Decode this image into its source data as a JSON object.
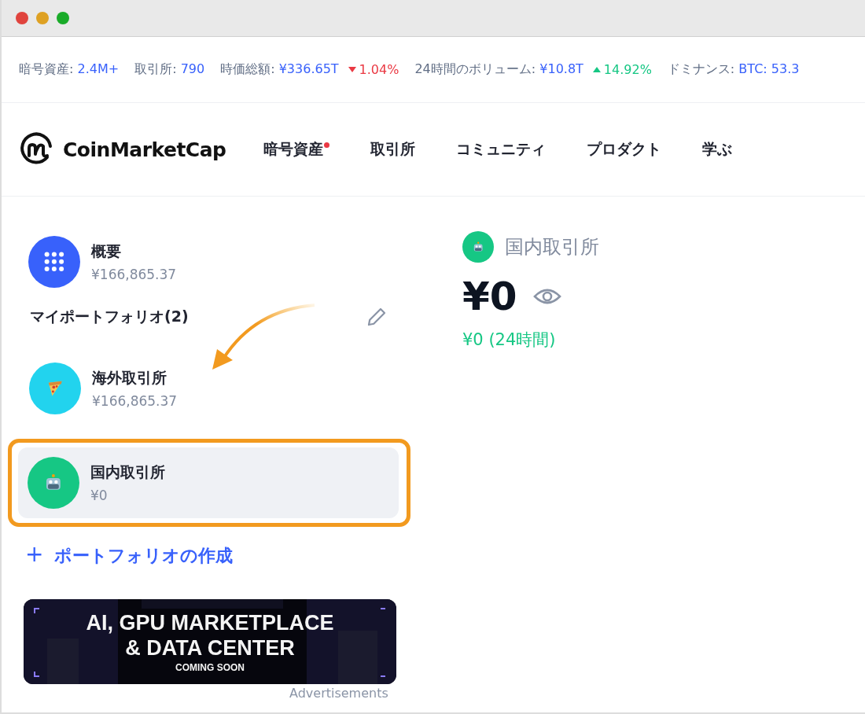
{
  "ticker": [
    {
      "label": "暗号資産:",
      "value": "2.4M+"
    },
    {
      "label": "取引所:",
      "value": "790"
    },
    {
      "label": "時価総額:",
      "value": "¥336.65T",
      "change": {
        "text": "1.04%",
        "rising": false
      }
    },
    {
      "label": "24時間のボリューム:",
      "value": "¥10.8T",
      "change": {
        "text": "14.92%",
        "rising": true
      }
    },
    {
      "label": "ドミナンス:",
      "value": "BTC: 53.3"
    }
  ],
  "header": {
    "logo": "CoinMarketCap",
    "nav": [
      {
        "label": "暗号資産",
        "badge": true
      },
      {
        "label": "取引所",
        "badge": false
      },
      {
        "label": "コミュニティ",
        "badge": false
      },
      {
        "label": "プロダクト",
        "badge": false
      },
      {
        "label": "学ぶ",
        "badge": false
      }
    ]
  },
  "overview": {
    "title": "概要",
    "value": "¥166,865.37",
    "color": "#3861fb",
    "kind": "grid"
  },
  "portfolios_heading": "マイポートフォリオ(2)",
  "portfolios": [
    {
      "name": "海外取引所",
      "value": "¥166,865.37",
      "color": "#22d3ee",
      "kind": "pizza",
      "selected": false,
      "highlighted": false
    },
    {
      "name": "国内取引所",
      "value": "¥0",
      "color": "#16c784",
      "kind": "robot",
      "selected": true,
      "highlighted": true
    }
  ],
  "create_link": {
    "icon": "+",
    "label": "ポートフォリオの作成"
  },
  "ad": {
    "line_1": "AI, GPU MARKETPLACE",
    "line_2": "& DATA CENTER",
    "line_3": "COMING SOON",
    "caption": "Advertisements"
  },
  "detail": {
    "name": "国内取引所",
    "color": "#16c784",
    "kind": "robot",
    "balance": "¥0",
    "change": "¥0 (24時間)"
  }
}
